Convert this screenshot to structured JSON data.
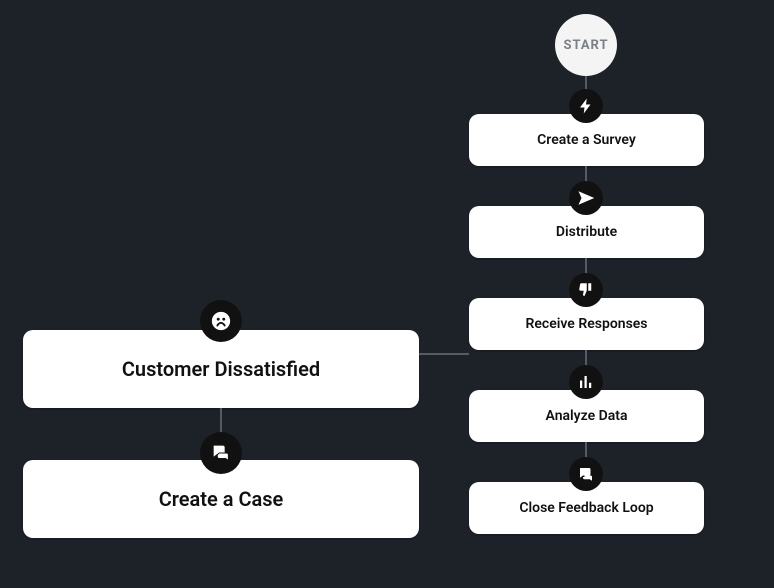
{
  "start_label": "START",
  "right_column": [
    {
      "label": "Create a Survey",
      "icon": "bolt"
    },
    {
      "label": "Distribute",
      "icon": "paper-plane"
    },
    {
      "label": "Receive Responses",
      "icon": "thumbs-down"
    },
    {
      "label": "Analyze Data",
      "icon": "bar-chart"
    },
    {
      "label": "Close Feedback Loop",
      "icon": "comments"
    }
  ],
  "left_column": [
    {
      "label": "Customer Dissatisfied",
      "icon": "frown"
    },
    {
      "label": "Create a Case",
      "icon": "chat"
    }
  ]
}
